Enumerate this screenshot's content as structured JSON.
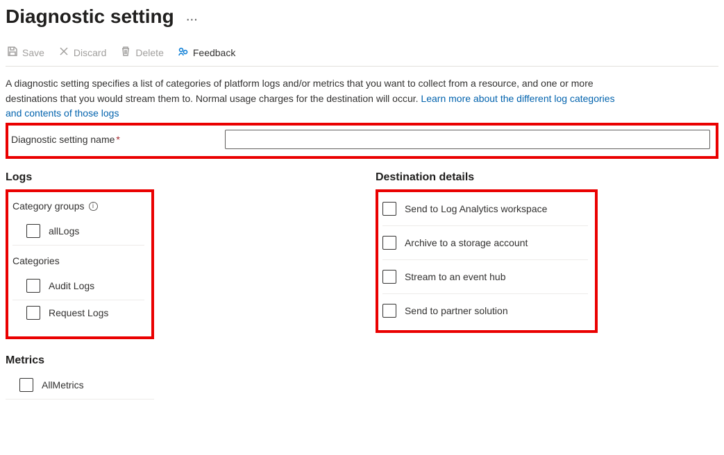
{
  "title": "Diagnostic setting",
  "toolbar": {
    "save": "Save",
    "discard": "Discard",
    "delete": "Delete",
    "feedback": "Feedback"
  },
  "description": {
    "text_before_link": "A diagnostic setting specifies a list of categories of platform logs and/or metrics that you want to collect from a resource, and one or more destinations that you would stream them to. Normal usage charges for the destination will occur. ",
    "link_text": "Learn more about the different log categories and contents of those logs"
  },
  "name_field": {
    "label": "Diagnostic setting name",
    "value": ""
  },
  "logs": {
    "heading": "Logs",
    "category_groups_label": "Category groups",
    "all_logs": "allLogs",
    "categories_label": "Categories",
    "items": [
      "Audit Logs",
      "Request Logs"
    ]
  },
  "metrics": {
    "heading": "Metrics",
    "all_metrics": "AllMetrics"
  },
  "destinations": {
    "heading": "Destination details",
    "items": [
      "Send to Log Analytics workspace",
      "Archive to a storage account",
      "Stream to an event hub",
      "Send to partner solution"
    ]
  }
}
